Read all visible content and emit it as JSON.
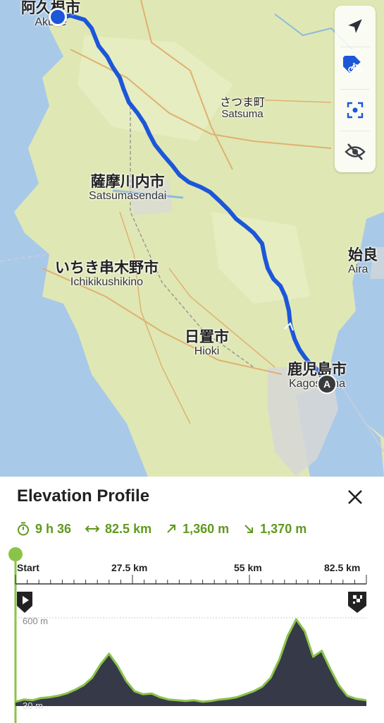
{
  "map": {
    "places": [
      {
        "id": "akune",
        "jp": "阿久根市",
        "en": "Akune"
      },
      {
        "id": "satsuma",
        "jp": "さつま町",
        "en": "Satsuma"
      },
      {
        "id": "satsumasendai",
        "jp": "薩摩川内市",
        "en": "Satsumasendai"
      },
      {
        "id": "ichikikushikino",
        "jp": "いちき串木野市",
        "en": "Ichikikushikino"
      },
      {
        "id": "hioki",
        "jp": "日置市",
        "en": "Hioki"
      },
      {
        "id": "kagoshima",
        "jp": "鹿児島市",
        "en": "Kagoshima"
      },
      {
        "id": "aira",
        "jp": "始良",
        "en": "Aira"
      }
    ],
    "end_marker": "A",
    "route_color": "#1c56d9",
    "controls": [
      "navigate-icon",
      "bike-icon",
      "recenter-icon",
      "hide-icon"
    ]
  },
  "panel": {
    "title": "Elevation Profile",
    "stats": {
      "duration": "9 h 36",
      "distance": "82.5 km",
      "ascent": "1,360 m",
      "descent": "1,370 m"
    },
    "axis": [
      "Start",
      "27.5 km",
      "55 km",
      "82.5 km"
    ],
    "elev_max": "600 m",
    "elev_min": "30 m",
    "accent": "#6aa12a"
  },
  "chart_data": {
    "type": "area",
    "x": [
      0,
      2,
      4,
      6,
      8,
      10,
      12,
      14,
      16,
      18,
      20,
      22,
      24,
      26,
      28,
      30,
      32,
      34,
      36,
      38,
      40,
      42,
      44,
      46,
      48,
      50,
      52,
      54,
      56,
      58,
      60,
      62,
      64,
      66,
      68,
      70,
      72,
      74,
      76,
      78,
      80,
      82.5
    ],
    "y": [
      40,
      55,
      50,
      65,
      70,
      80,
      95,
      120,
      150,
      200,
      290,
      360,
      280,
      180,
      110,
      90,
      95,
      70,
      55,
      50,
      45,
      50,
      40,
      45,
      55,
      60,
      70,
      90,
      110,
      140,
      200,
      320,
      480,
      590,
      510,
      340,
      380,
      260,
      150,
      80,
      60,
      50
    ],
    "xlabel": "",
    "ylabel": "",
    "xlim": [
      0,
      82.5
    ],
    "ylim": [
      30,
      600
    ],
    "xticks": [
      "Start",
      "27.5 km",
      "55 km",
      "82.5 km"
    ],
    "yticks": [
      "30 m",
      "600 m"
    ],
    "fill": "#363a48",
    "line": "#8bc34a"
  }
}
